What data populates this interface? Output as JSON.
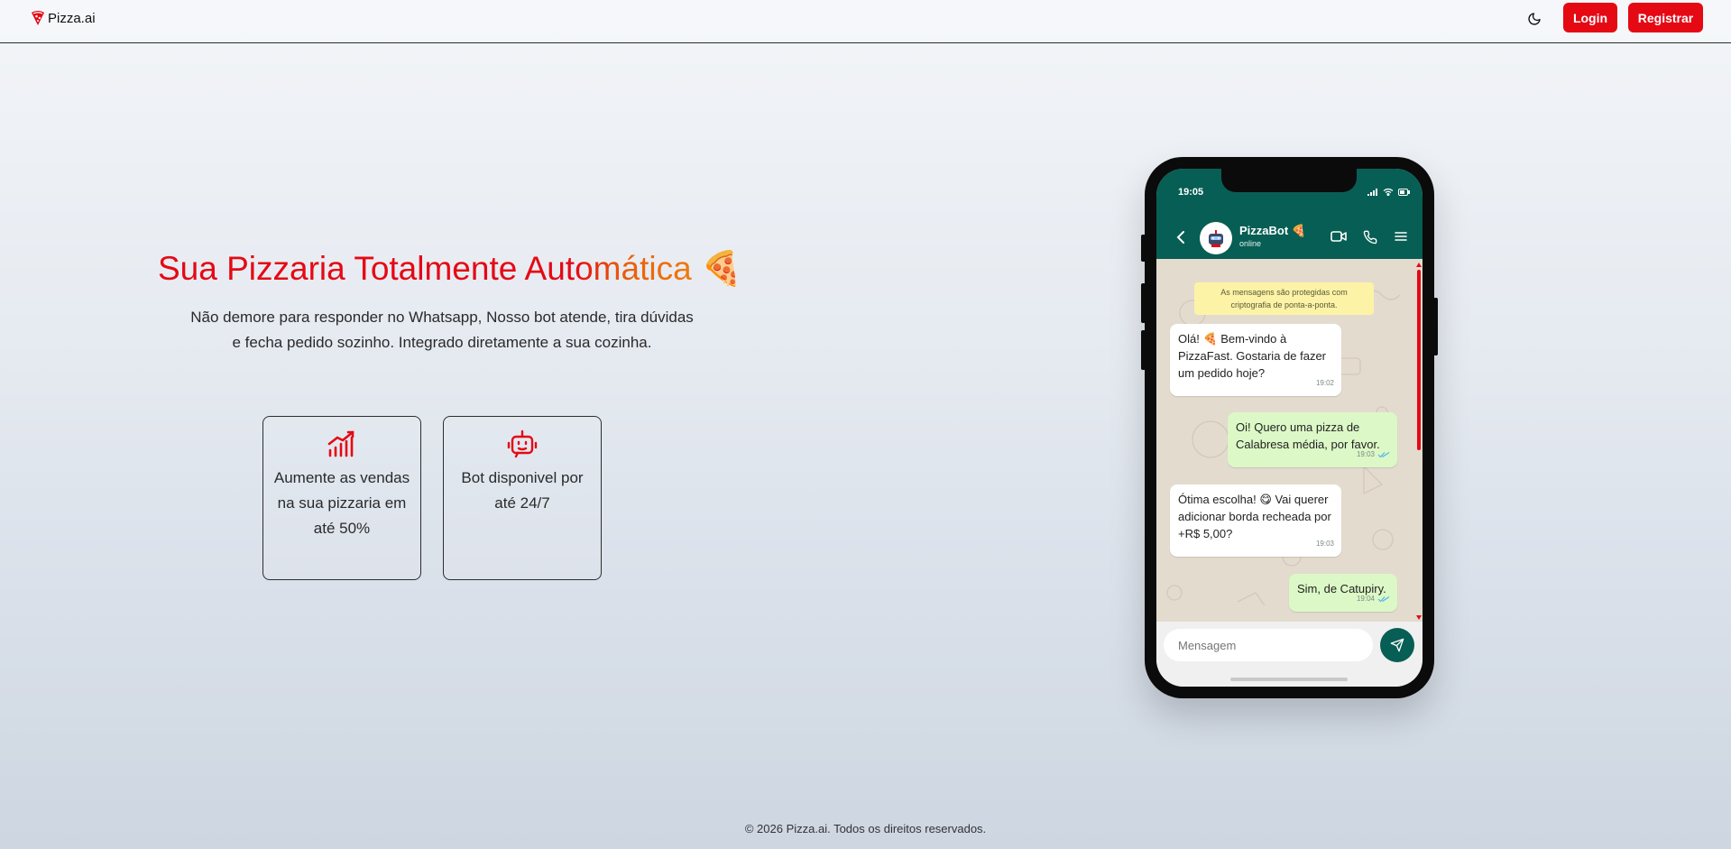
{
  "header": {
    "brand": "Pizza.ai",
    "login_label": "Login",
    "register_label": "Registrar",
    "theme_icon": "moon-icon"
  },
  "hero": {
    "title_part1": "Sua Pizzaria Totalmente Aut",
    "title_part2": "omática",
    "title_emoji": "🍕",
    "description": "Não demore para responder no Whatsapp, Nosso bot atende, tira dúvidas e fecha pedido sozinho. Integrado diretamente a sua cozinha."
  },
  "features": [
    {
      "icon": "chart-growth-icon",
      "text": "Aumente as vendas na sua pizzaria em até 50%"
    },
    {
      "icon": "robot-icon",
      "text": "Bot disponivel por até 24/7"
    }
  ],
  "phone": {
    "status_time": "19:05",
    "contact_name": "PizzaBot 🍕",
    "contact_status": "online",
    "encryption_note": "As mensagens são protegidas com criptografia de ponta-a-ponta.",
    "messages": [
      {
        "direction": "in",
        "text": "Olá! 🍕 Bem-vindo à PizzaFast. Gostaria de fazer um pedido hoje?",
        "time": "19:02"
      },
      {
        "direction": "out",
        "text": "Oi! Quero uma pizza de Calabresa média, por favor.",
        "time": "19:03"
      },
      {
        "direction": "in",
        "text": "Ótima escolha! 😋 Vai querer adicionar borda recheada por +R$ 5,00?",
        "time": "19:03"
      },
      {
        "direction": "out",
        "text": "Sim, de Catupiry.",
        "time": "19:04"
      }
    ],
    "input_placeholder": "Mensagem"
  },
  "colors": {
    "accent": "#e50914",
    "whatsapp_green": "#075e54",
    "outgoing_bubble": "#dcf8c6"
  },
  "footer": {
    "text": "© 2026 Pizza.ai. Todos os direitos reservados."
  }
}
